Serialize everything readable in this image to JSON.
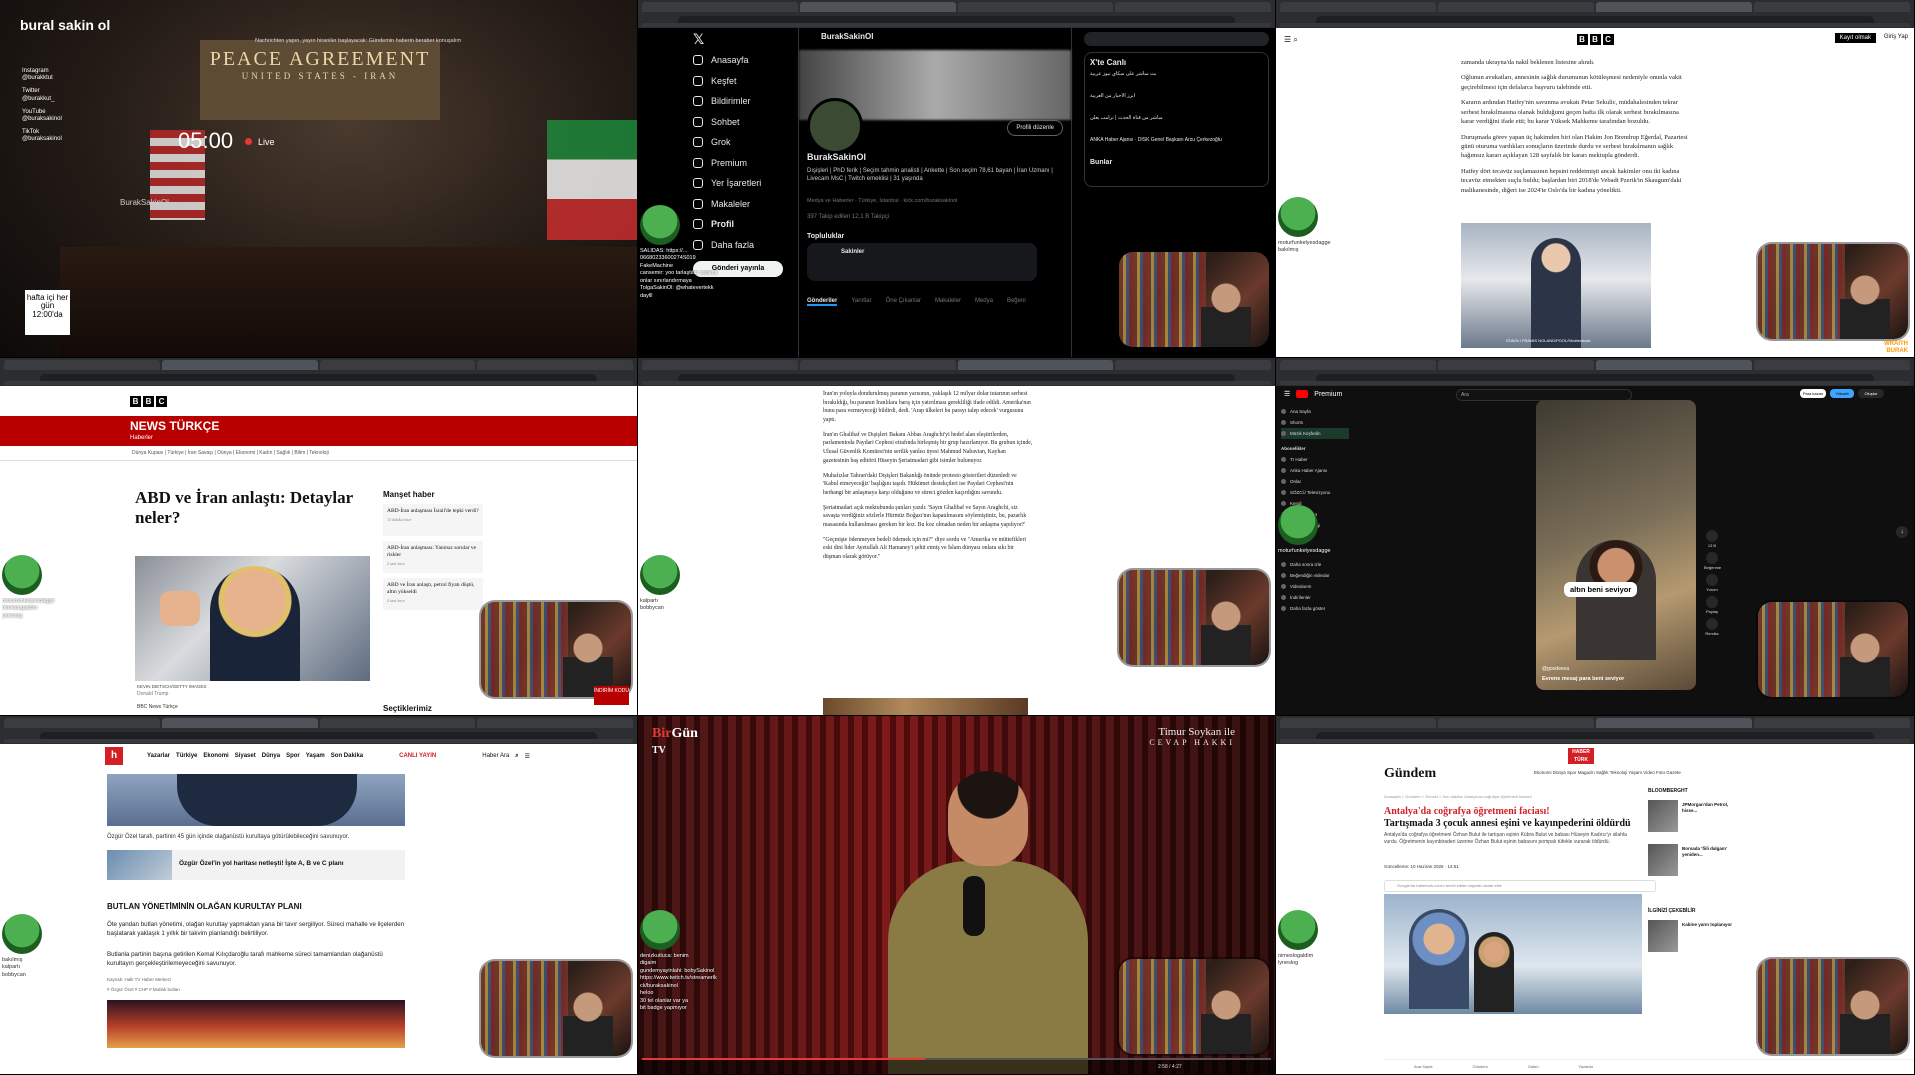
{
  "tile1": {
    "logo": "bural sakin ol",
    "top_note": "Nachrichten yapın, yayın hiraniler başlayacak: Gündemin haberin beraber konuşalım",
    "banner_big": "PEACE AGREEMENT",
    "banner_sub": "UNITED STATES - IRAN",
    "timer": "05:00",
    "live_label": "Live",
    "socials": [
      {
        "platform": "Instagram",
        "handle": "@burakktut"
      },
      {
        "platform": "Twitter",
        "handle": "@burakkut_"
      },
      {
        "platform": "YouTube",
        "handle": "@buraksakinol"
      },
      {
        "platform": "TikTok",
        "handle": "@buraksakinol"
      }
    ],
    "handle": "BurakSakinOl",
    "schedule": "hafta içi her gün 12:00'da"
  },
  "tile2": {
    "nav": [
      "Anasayfa",
      "Keşfet",
      "Bildirimler",
      "Sohbet",
      "Grok",
      "Premium",
      "Yer İşaretleri",
      "Makaleler",
      "Profil",
      "Daha fazla"
    ],
    "post_button": "Gönderi yayınla",
    "profile_header": "BurakSakinOl",
    "edit_profile": "Profili düzenle",
    "profile_name": "BurakSakinOl",
    "bio": "Dışişleri | PhD ferik | Seçim tahmin analisti | Ankette | Son seçim 78,61 bayan | İran Uzmanı | Livecam MsC | Twitch emeklisi | 31 yaşında",
    "meta": "Medya ve Haberler · Türkiye, İstanbul · kick.com/buraksakinol",
    "stats": "397 Takip edilen   12,1 B Takipçi",
    "communities_title": "Topluluklar",
    "community_name": "Sakinler",
    "profile_tabs": [
      "Gönderiler",
      "Yanıtlar",
      "Öne Çıkanlar",
      "Makaleler",
      "Medya",
      "Beğeni"
    ],
    "trends_title": "X'te Canlı",
    "trends": [
      "بث مباشر على سكاي نيوز عربية",
      "أبرز الأخبار من العربية",
      "مباشر من قناة الحدث | ترامب يعلن",
      "ANKA Haber Ajansı · DİSK Genel Başkanı Arzu Çerkezoğlu"
    ],
    "trends_more": "Bunlar",
    "chat": [
      "SALIDAS: https://...",
      "06680233600274S019",
      "FakeMachine",
      "cansemir: yoo tarlaştılar sadece",
      "onlar sınırlandırmaya",
      "TolgaSakinOl: @whatevertekk",
      "daylll"
    ]
  },
  "tile3": {
    "menu_icon": "menu-search-icon",
    "bbc": [
      "B",
      "B",
      "C"
    ],
    "register": "Kayıt olmak",
    "login": "Giriş Yap",
    "paragraphs": [
      "zamanda ukrayna'da nakil beklenen listesine alındı.",
      "Oğlunun avukatları, annesinin sağlık durumunun kötüleşmesi nedeniyle onunla vakit geçirebilmesi için defalarca başvuru talebinde etti.",
      "Kararın ardından Hatfey'nin savunma avukatı Petar Sekulic, müdahalesinden tekrar serbest bırakılmasına olanak bulduğunu geçen hafta ilk olarak serbest bırakılmasına karar verdiğini ifade etti; bu karar Yüksek Mahkeme tarafından bozuldu.",
      "Duruşmada görev yapan üç hakimden biri olan Hakim Jon Brendrup Eğerdal, Pazartesi günü oturuma vardıkları sonuçların üzerinde durdu ve serbest bırakılmanın sağlık bağımsız kararı açıklayan 128 sayfalık bir kararı mektupla gönderdi.",
      "Hatfey dört tecavüz suçlamasının hepsini reddetmişti ancak hakimler onu iki kadına tecavüz etmekten suçlu buldu; başlardan biri 2018'de Vebadt Pzerik'in Skaugum'daki malikanesinde, diğeri ise 2024'te Oslo'da bir kadına yönelikti."
    ],
    "photo_caption": "STAVN / FRAMIS NOLAND/POOL/Shutterstock"
  },
  "tile4": {
    "bbc": [
      "B",
      "B",
      "C"
    ],
    "news": "NEWS TÜRKÇE",
    "sub": "Haberler",
    "subnav": "Dünya Kupası | Türkiye | İran Savaşı | Dünya | Ekonomi | Kadın | Sağlık | Bilim | Teknoloji",
    "headline": "ABD ve İran anlaştı: Detaylar neler?",
    "photo_credit": "KEVIN DIETSCH/GETTY IMAGES",
    "photo_source": "Donald Trump",
    "source_line": "BBC News Türkçe",
    "manset_title": "Manşet haber",
    "manset": [
      {
        "title": "ABD-İran anlaşması İsrail'de tepki verdi?",
        "age": "13 dakika önce"
      },
      {
        "title": "ABD-İran anlaşması: Yanıtsız sorular ve riskler",
        "age": "2 saat önce"
      },
      {
        "title": "ABD ve İran anlaştı, petrol fiyatı düştü, altın yükseldi",
        "age": "4 saat önce"
      }
    ],
    "secilen": "Seçtiklerimiz",
    "tag": "İNDİRİM KODU"
  },
  "tile5": {
    "paragraphs": [
      "İran'ın yoluyla dondurulmuş paranın yarısının, yaklaşık 12 milyar dolar tutarının serbest bırakıldığı, bu paranın İranlılara barış için yatırılması gerekliliği ifade edildi. Amerika'nın bunu para vermeyeceği bildirdi, dedi. 'Arap ülkeleri bu parayı talep edecek' vurgusunu yaptı.",
      "İran'ın Ghalibaf ve Dışişleri Bakanı Abbas Araghchi'yi hedef alan eleştirilerden, parlamentoda Paydari Cephesi etrafında birleşmiş bir grup hazırlanıyor. Bu grubun içinde, Ulusal Güvenlik Komitesi'nin sertlik yanlısı üyesi Mahmud Nabavian, Kayhan gazetesinin baş editörü Hüseyin Şeriatmadari gibi isimler bulunuyor.",
      "Muhafızlar Tahran'daki Dışişleri Bakanlığı önünde protesto gösterileri düzenledi ve 'Kabul etmeyeceğiz' başlığını taşıdı. Hükümet destekçileri ise Paydari Cephesi'nin herhangi bir anlaşmaya karşı olduğunu ve süreci gözden kaçırdığını savundu.",
      "Şeriatmadari açık mektubunda şunları yazdı: 'Sayın Ghalibaf ve Sayın Araghchi, siz savaşta verdiğiniz sözlerle Hürmüz Boğazı'nın kapatılmasını söylemiştiniz, bu, pazarlık masasında kullanılması gereken bir koz. Bu koz olmadan neden bir anlaşma yapılıyor?'",
      "\"Geçmişte ödenmeyen bedeli ödemek için mi?\" diye sordu ve \"Amerika ve müttefikleri eski dini lider Ayetullah Ali Hamaney'i şehit etmiş ve İslam dünyası onlara sıkı bir düşman olarak görüyor.\""
    ]
  },
  "tile6": {
    "brand": "Premium",
    "search_placeholder": "Ara",
    "sidebar": [
      "Ana Sayfa",
      "Shorts",
      "Müzik Keşfedin",
      "Abonelikler",
      "Tr Haber",
      "Anka Haber Ajansı",
      "Onlar",
      "SÖZCÜ Televizyonu",
      "Kendi",
      "Kanal Kültürü",
      "Sozcuka Gezgi",
      "Daha sonra izle",
      "Beğendiğin videolar",
      "Videolarım",
      "İndirilenler",
      "Daha fazla göster"
    ],
    "caption": "altın beni seviyor",
    "short_user": "@goodeeva",
    "short_title": "Evrene mesaj para beni seviyor",
    "buttons": [
      "Para kazan",
      "Yükselt",
      "Oluştur"
    ],
    "actions": [
      "13 B",
      "Beğenme",
      "Yorum",
      "Paylaş",
      "Remiks"
    ]
  },
  "tile7": {
    "nav": [
      "Yazarlar",
      "Türkiye",
      "Ekonomi",
      "Siyaset",
      "Dünya",
      "Spor",
      "Yaşam",
      "Son Dakika"
    ],
    "live": "CANLI YAYIN",
    "search": "Haber Ara",
    "p1": "Özgür Özel tarafı, partinin 45 gün içinde olağanüstü kurultaya götürülebileceğini savunuyor.",
    "card": "Özgür Özel'in yol haritası netleşti! İşte A, B ve C planı",
    "h2": "BUTLAN YÖNETİMİNİN OLAĞAN KURULTAY PLANI",
    "p2": "Öte yandan butlan yönetimi, olağan kurultay yapmaktan yana bir tavır sergiliyor. Süreci mahalle ve ilçelerden başlatarak yaklaşık 1 yıllık bir takvim planlandığı belirtiliyor.",
    "p3": "Butlanla partinin başına getirilen Kemal Kılıçdaroğlu tarafı mahkeme süreci tamamlandan olağanüstü kurultayın gerçekleştirilemeyeceğini savunuyor.",
    "source": "Kaynak: Halk TV Haber Merkezi",
    "tags": "# Özgür Özel  # CHP  # Mutlak butlan"
  },
  "tile8": {
    "logo_a": "Bir",
    "logo_b": "Gün",
    "logo_c": "TV",
    "show": "Timur Soykan ile",
    "show_sub": "CEVAP HAKKI",
    "time": "2:58 / 4:27",
    "chat": [
      "denizkutluca: benim",
      "digaim",
      "gundemyayinlahi: bobySakinol",
      "https://www.twitch.tv/streamerlk",
      "ck/buraksakinol",
      "heloo",
      "30 tel olanlar var ya",
      "bit badge yapmıyor"
    ]
  },
  "tile9": {
    "logo": "HABER TÜRK",
    "section": "Gündem",
    "nav": "Ekonomi  Dünya  Spor  Magazin  Sağlık  Teknoloji  Yaşam  Video  Foto  Gazete",
    "breadcrumb": "Anasayfa > Gündem > Güncel > Son dakika: Antalya'da coğrafya öğretmeni faciası!",
    "headline_a": "Antalya'da coğrafya öğretmeni faciası!",
    "headline_b": "Tartışmada 3 çocuk annesi eşini ve kayınpederini öldürdü",
    "lead": "Antalya'da coğrafya öğretmeni Özhan Bulut ile tartışan eşinin Kübra Bulut ve babası Hüseyin Kadırcı'yı silahla vurdu. Öğretmenin kayınbiraderi üzerine Özhan Bulut eşinin babasını pompalı tüfekle vurarak öldürdü.",
    "byline": "Güncelleme: 10 Haziran 2026 · 14:51",
    "google": "Google'da haberturk.com'u tercih edilen kaynak olarak ekle",
    "bloom": "BLOOMBERGHT",
    "side": [
      "JPMorgan'dan Petrol, hisse...",
      "Borsada 'fiili dalgam' yeniden..."
    ],
    "ilgili": "İLGİNİZİ ÇEKEBİLİR",
    "side2": "Kabine yarın toplanıyor",
    "bottom": [
      "Ana Sayfa",
      "Gündem",
      "Galeri",
      "Yazarlar"
    ]
  },
  "streamer": {
    "tag": "WRAITH BURAK",
    "chat_lines": [
      "moturfunkelyesdagge",
      "bakılmış",
      "nimeslogaldim",
      "lyneslog",
      "kalpartı",
      "bobbycan"
    ]
  }
}
